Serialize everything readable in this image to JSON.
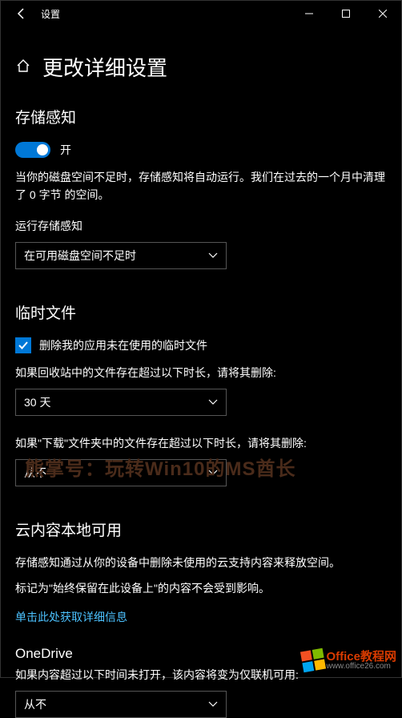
{
  "titlebar": {
    "title": "设置"
  },
  "header": {
    "page_title": "更改详细设置"
  },
  "storage_sense": {
    "heading": "存储感知",
    "toggle_label": "开",
    "description": "当你的磁盘空间不足时，存储感知将自动运行。我们在过去的一个月中清理了 0 字节 的空间。",
    "run_label": "运行存储感知",
    "run_value": "在可用磁盘空间不足时"
  },
  "temp_files": {
    "heading": "临时文件",
    "checkbox_label": "删除我的应用未在使用的临时文件",
    "recycle_label": "如果回收站中的文件存在超过以下时长，请将其删除:",
    "recycle_value": "30 天",
    "downloads_label": "如果\"下载\"文件夹中的文件存在超过以下时长，请将其删除:",
    "downloads_value": "从不"
  },
  "cloud": {
    "heading": "云内容本地可用",
    "line1": "存储感知通过从你的设备中删除未使用的云支持内容来释放空间。",
    "line2": "标记为\"始终保留在此设备上\"的内容不会受到影响。",
    "link": "单击此处获取详细信息",
    "subheading": "OneDrive",
    "onedrive_label": "如果内容超过以下时间未打开，该内容将变为仅联机可用:",
    "onedrive_value": "从不"
  },
  "watermark": {
    "text1": "熊掌号：玩转Win10的MS酋长",
    "brand": "Office教程网",
    "url": "www.office26.com"
  }
}
